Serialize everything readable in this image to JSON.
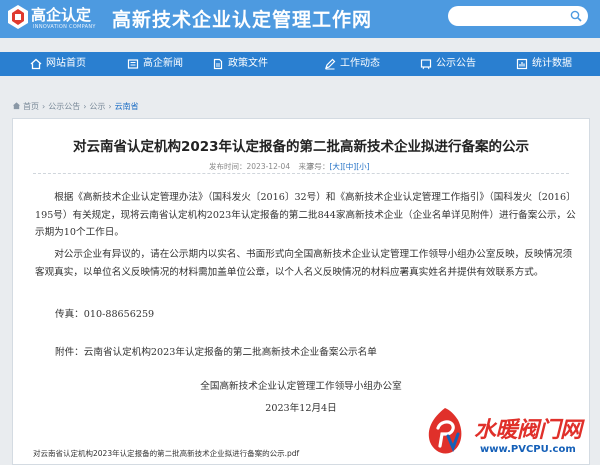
{
  "header": {
    "logo_text": "高企认定",
    "logo_subtext": "INNOVATION COMPANY",
    "site_title": "高新技术企业认定管理工作网",
    "search_placeholder": ""
  },
  "nav": {
    "items": [
      {
        "label": "网站首页",
        "icon": "home-icon"
      },
      {
        "label": "高企新闻",
        "icon": "news-icon"
      },
      {
        "label": "政策文件",
        "icon": "document-icon"
      },
      {
        "label": "工作动态",
        "icon": "pen-icon"
      },
      {
        "label": "公示公告",
        "icon": "announcement-icon"
      },
      {
        "label": "统计数据",
        "icon": "chart-icon"
      }
    ]
  },
  "breadcrumb": {
    "items": [
      "首页",
      "公示公告",
      "公示",
      "云南省"
    ],
    "separator": "›"
  },
  "article": {
    "title": "对云南省认定机构2023年认定报备的第二批高新技术企业拟进行备案的公示",
    "publish_label": "发布时间：",
    "publish_date": "2023-12-04",
    "source_label": "来源：",
    "font_size_label": "字号：",
    "font_sizes": [
      "[大]",
      "[中]",
      "[小]"
    ],
    "paragraph_1": "根据《高新技术企业认定管理办法》（国科发火〔2016〕32号）和《高新技术企业认定管理工作指引》（国科发火〔2016〕195号）有关规定，现将云南省认定机构2023年认定报备的第二批844家高新技术企业（企业名单详见附件）进行备案公示，公示期为10个工作日。",
    "paragraph_2": "对公示企业有异议的，请在公示期内以实名、书面形式向全国高新技术企业认定管理工作领导小组办公室反映，反映情况须客观真实，以单位名义反映情况的材料需加盖单位公章，以个人名义反映情况的材料应署真实姓名并提供有效联系方式。",
    "fax": "传真：010-88656259",
    "attachment": "附件：云南省认定机构2023年认定报备的第二批高新技术企业备案公示名单",
    "signature_org": "全国高新技术企业认定管理工作领导小组办公室",
    "signature_date": "2023年12月4日",
    "pdf_file": "对云南省认定机构2023年认定报备的第二批高新技术企业拟进行备案的公示.pdf"
  },
  "watermark": {
    "text": "水暖阀门网",
    "url": "www.PVCPU.com"
  },
  "colors": {
    "header_bg": "#4d9ae0",
    "nav_bg": "#2a7fd0",
    "link": "#1f6fc5",
    "watermark_red": "#e0302a"
  }
}
